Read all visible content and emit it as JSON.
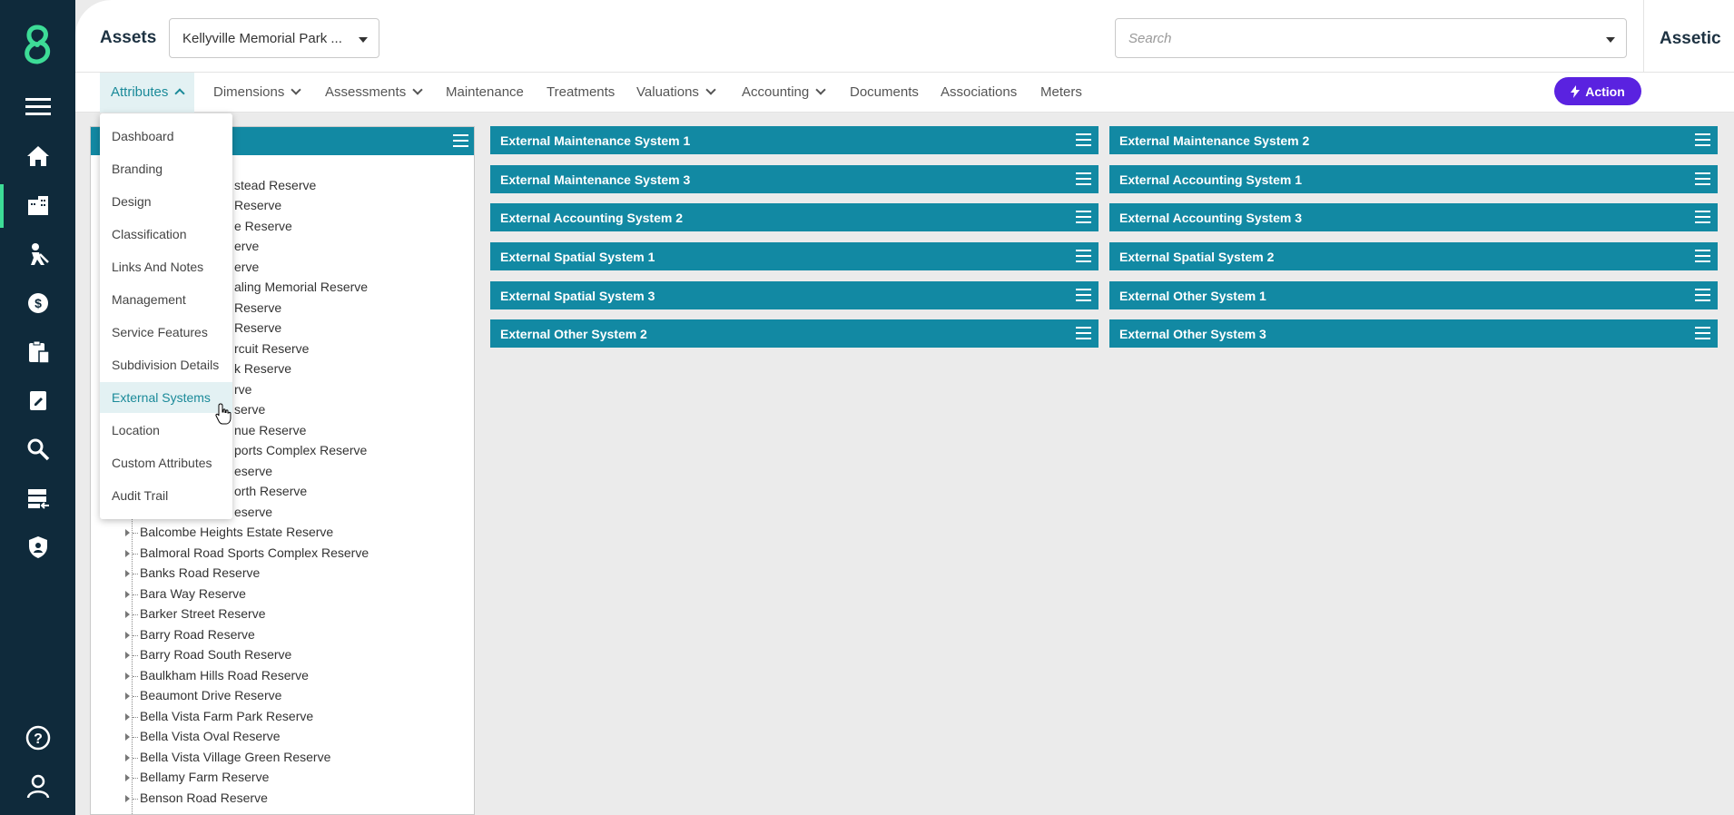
{
  "header": {
    "title": "Assets",
    "asset_selector_value": "Kellyville Memorial Park ...",
    "search_placeholder": "Search",
    "brand": "Assetic"
  },
  "tabs": [
    {
      "label": "Attributes",
      "has_dropdown": true,
      "active": true
    },
    {
      "label": "Dimensions",
      "has_dropdown": true
    },
    {
      "label": "Assessments",
      "has_dropdown": true
    },
    {
      "label": "Maintenance"
    },
    {
      "label": "Treatments"
    },
    {
      "label": "Valuations",
      "has_dropdown": true
    },
    {
      "label": "Accounting",
      "has_dropdown": true
    },
    {
      "label": "Documents"
    },
    {
      "label": "Associations"
    },
    {
      "label": "Meters"
    }
  ],
  "action_button": "Action",
  "attributes_menu": [
    "Dashboard",
    "Branding",
    "Design",
    "Classification",
    "Links And Notes",
    "Management",
    "Service Features",
    "Subdivision Details",
    "External Systems",
    "Location",
    "Custom Attributes",
    "Audit Trail"
  ],
  "attributes_menu_selected": "External Systems",
  "tree_items_partial": [
    "stead Reserve",
    "Reserve",
    "e Reserve",
    "erve",
    "erve",
    "aling Memorial Reserve",
    "Reserve",
    "Reserve",
    "rcuit Reserve",
    "k Reserve",
    "rve",
    "serve",
    "nue Reserve",
    "ports Complex Reserve",
    "eserve",
    "orth Reserve",
    "eserve"
  ],
  "tree_items": [
    "Balcombe Heights Estate Reserve",
    "Balmoral Road Sports Complex Reserve",
    "Banks Road Reserve",
    "Bara Way Reserve",
    "Barker Street Reserve",
    "Barry Road Reserve",
    "Barry Road South Reserve",
    "Baulkham Hills Road Reserve",
    "Beaumont Drive Reserve",
    "Bella Vista Farm Park Reserve",
    "Bella Vista Oval Reserve",
    "Bella Vista Village Green Reserve",
    "Bellamy Farm Reserve",
    "Benson Road Reserve"
  ],
  "external_systems": [
    "External Maintenance System 1",
    "External Maintenance System 2",
    "External Maintenance System 3",
    "External Accounting System 1",
    "External Accounting System 2",
    "External Accounting System 3",
    "External Spatial System 1",
    "External Spatial System 2",
    "External Spatial System 3",
    "External Other System 1",
    "External Other System 2",
    "External Other System 3"
  ],
  "colors": {
    "rail": "#0f2a3b",
    "accent": "#1289a3",
    "action": "#5a22e0",
    "rail_active": "#3ddc97"
  },
  "rail_icons": [
    "menu-icon",
    "home-icon",
    "buildings-icon",
    "worker-icon",
    "finance-icon",
    "clipboard-icon",
    "edit-icon",
    "search-icon",
    "database-icon",
    "shield-icon",
    "help-icon",
    "user-icon"
  ]
}
